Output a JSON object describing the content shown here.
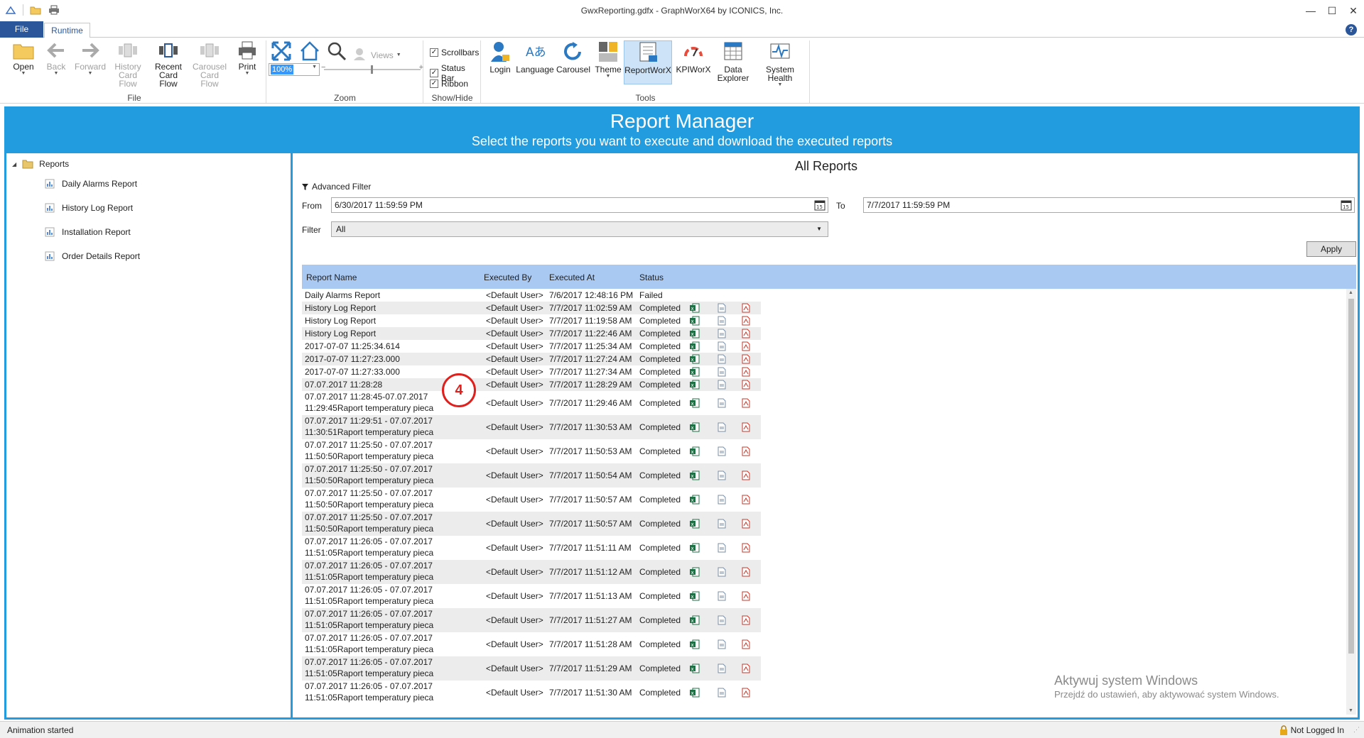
{
  "window": {
    "title": "GwxReporting.gdfx - GraphWorX64 by ICONICS, Inc."
  },
  "tabs": {
    "file": "File",
    "runtime": "Runtime"
  },
  "ribbon": {
    "file_group": {
      "label": "File",
      "buttons": {
        "open": "Open",
        "back": "Back",
        "forward": "Forward",
        "history1": "History",
        "history2": "Card Flow",
        "recent1": "Recent",
        "recent2": "Card Flow",
        "carousel1": "Carousel",
        "carousel2": "Card Flow",
        "print": "Print"
      }
    },
    "zoom_group": {
      "label": "Zoom",
      "zoom_value": "100%",
      "views": "Views"
    },
    "showhide_group": {
      "label": "Show/Hide",
      "scrollbars": "Scrollbars",
      "statusbar": "Status Bar",
      "ribbon": "Ribbon"
    },
    "tools_group": {
      "label": "Tools",
      "login": "Login",
      "language": "Language",
      "carousel": "Carousel",
      "theme": "Theme",
      "reportworx": "ReportWorX",
      "kpiworx": "KPIWorX",
      "data1": "Data",
      "data2": "Explorer",
      "health": "System Health"
    }
  },
  "banner": {
    "title": "Report Manager",
    "subtitle": "Select the reports you want to execute and download the executed reports"
  },
  "tree": {
    "root": "Reports",
    "items": [
      "Daily Alarms Report",
      "History Log Report",
      "Installation Report",
      "Order Details Report"
    ]
  },
  "main": {
    "title": "All Reports",
    "advanced_filter": "Advanced Filter",
    "from_label": "From",
    "from_value": "6/30/2017 11:59:59 PM",
    "to_label": "To",
    "to_value": "7/7/2017 11:59:59 PM",
    "filter_label": "Filter",
    "filter_value": "All",
    "apply": "Apply",
    "columns": {
      "name": "Report Name",
      "by": "Executed By",
      "at": "Executed At",
      "status": "Status"
    },
    "rows": [
      {
        "name": [
          "Daily Alarms Report"
        ],
        "by": "<Default User>",
        "at": "7/6/2017 12:48:16 PM",
        "status": "Failed",
        "icons": false
      },
      {
        "name": [
          "History Log Report"
        ],
        "by": "<Default User>",
        "at": "7/7/2017 11:02:59 AM",
        "status": "Completed",
        "icons": true
      },
      {
        "name": [
          "History Log Report"
        ],
        "by": "<Default User>",
        "at": "7/7/2017 11:19:58 AM",
        "status": "Completed",
        "icons": true
      },
      {
        "name": [
          "History Log Report"
        ],
        "by": "<Default User>",
        "at": "7/7/2017 11:22:46 AM",
        "status": "Completed",
        "icons": true
      },
      {
        "name": [
          "2017-07-07 11:25:34.614"
        ],
        "by": "<Default User>",
        "at": "7/7/2017 11:25:34 AM",
        "status": "Completed",
        "icons": true
      },
      {
        "name": [
          "2017-07-07 11:27:23.000"
        ],
        "by": "<Default User>",
        "at": "7/7/2017 11:27:24 AM",
        "status": "Completed",
        "icons": true
      },
      {
        "name": [
          "2017-07-07 11:27:33.000"
        ],
        "by": "<Default User>",
        "at": "7/7/2017 11:27:34 AM",
        "status": "Completed",
        "icons": true
      },
      {
        "name": [
          "07.07.2017 11:28:28"
        ],
        "by": "<Default User>",
        "at": "7/7/2017 11:28:29 AM",
        "status": "Completed",
        "icons": true
      },
      {
        "name": [
          "07.07.2017 11:28:45-07.07.2017",
          "11:29:45Raport temperatury pieca"
        ],
        "by": "<Default User>",
        "at": "7/7/2017 11:29:46 AM",
        "status": "Completed",
        "icons": true
      },
      {
        "name": [
          "07.07.2017 11:29:51 - 07.07.2017",
          "11:30:51Raport temperatury pieca"
        ],
        "by": "<Default User>",
        "at": "7/7/2017 11:30:53 AM",
        "status": "Completed",
        "icons": true
      },
      {
        "name": [
          "07.07.2017 11:25:50 - 07.07.2017",
          "11:50:50Raport temperatury pieca"
        ],
        "by": "<Default User>",
        "at": "7/7/2017 11:50:53 AM",
        "status": "Completed",
        "icons": true
      },
      {
        "name": [
          "07.07.2017 11:25:50 - 07.07.2017",
          "11:50:50Raport temperatury pieca"
        ],
        "by": "<Default User>",
        "at": "7/7/2017 11:50:54 AM",
        "status": "Completed",
        "icons": true
      },
      {
        "name": [
          "07.07.2017 11:25:50 - 07.07.2017",
          "11:50:50Raport temperatury pieca"
        ],
        "by": "<Default User>",
        "at": "7/7/2017 11:50:57 AM",
        "status": "Completed",
        "icons": true
      },
      {
        "name": [
          "07.07.2017 11:25:50 - 07.07.2017",
          "11:50:50Raport temperatury pieca"
        ],
        "by": "<Default User>",
        "at": "7/7/2017 11:50:57 AM",
        "status": "Completed",
        "icons": true
      },
      {
        "name": [
          "07.07.2017 11:26:05 - 07.07.2017",
          "11:51:05Raport temperatury pieca"
        ],
        "by": "<Default User>",
        "at": "7/7/2017 11:51:11 AM",
        "status": "Completed",
        "icons": true
      },
      {
        "name": [
          "07.07.2017 11:26:05 - 07.07.2017",
          "11:51:05Raport temperatury pieca"
        ],
        "by": "<Default User>",
        "at": "7/7/2017 11:51:12 AM",
        "status": "Completed",
        "icons": true
      },
      {
        "name": [
          "07.07.2017 11:26:05 - 07.07.2017",
          "11:51:05Raport temperatury pieca"
        ],
        "by": "<Default User>",
        "at": "7/7/2017 11:51:13 AM",
        "status": "Completed",
        "icons": true
      },
      {
        "name": [
          "07.07.2017 11:26:05 - 07.07.2017",
          "11:51:05Raport temperatury pieca"
        ],
        "by": "<Default User>",
        "at": "7/7/2017 11:51:27 AM",
        "status": "Completed",
        "icons": true
      },
      {
        "name": [
          "07.07.2017 11:26:05 - 07.07.2017",
          "11:51:05Raport temperatury pieca"
        ],
        "by": "<Default User>",
        "at": "7/7/2017 11:51:28 AM",
        "status": "Completed",
        "icons": true
      },
      {
        "name": [
          "07.07.2017 11:26:05 - 07.07.2017",
          "11:51:05Raport temperatury pieca"
        ],
        "by": "<Default User>",
        "at": "7/7/2017 11:51:29 AM",
        "status": "Completed",
        "icons": true
      },
      {
        "name": [
          "07.07.2017 11:26:05 - 07.07.2017",
          "11:51:05Raport temperatury pieca"
        ],
        "by": "<Default User>",
        "at": "7/7/2017 11:51:30 AM",
        "status": "Completed",
        "icons": true
      }
    ]
  },
  "marker": "4",
  "watermark": {
    "line1": "Aktywuj system Windows",
    "line2": "Przejdź do ustawień, aby aktywować system Windows."
  },
  "statusbar": {
    "left": "Animation started",
    "right": "Not Logged In"
  },
  "colors": {
    "accent": "#229cdf",
    "header": "#a9c9f2",
    "file_tab": "#2b579a",
    "marker": "#e0201c"
  }
}
